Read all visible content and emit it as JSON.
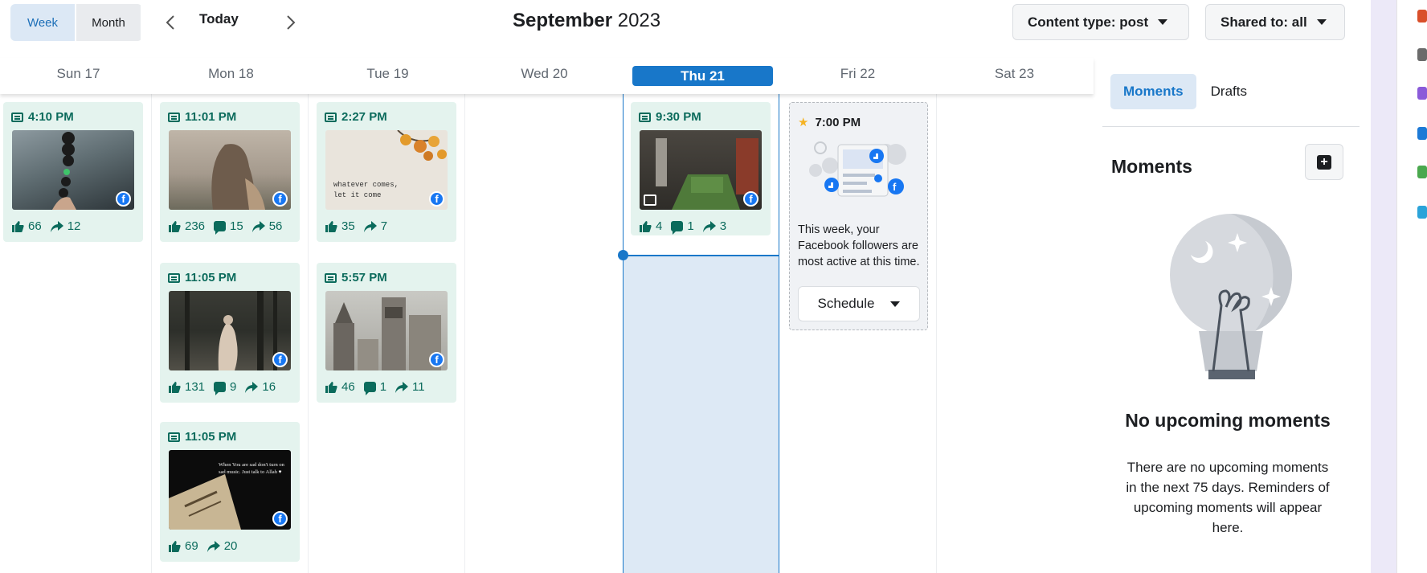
{
  "toolbar": {
    "week_label": "Week",
    "month_label": "Month",
    "today_label": "Today",
    "prev_icon": "chevron-left-icon",
    "next_icon": "chevron-right-icon",
    "month_name": "September",
    "year": "2023",
    "content_type_label": "Content type: post",
    "shared_to_label": "Shared to: all"
  },
  "days": [
    {
      "label": "Sun 17",
      "today": false
    },
    {
      "label": "Mon 18",
      "today": false
    },
    {
      "label": "Tue 19",
      "today": false
    },
    {
      "label": "Wed 20",
      "today": false
    },
    {
      "label": "Thu 21",
      "today": true
    },
    {
      "label": "Fri 22",
      "today": false
    },
    {
      "label": "Sat 23",
      "today": false
    }
  ],
  "posts": {
    "sun_1": {
      "time": "4:10 PM",
      "likes": "66",
      "shares": "12"
    },
    "mon_1": {
      "time": "11:01 PM",
      "likes": "236",
      "comments": "15",
      "shares": "56"
    },
    "mon_2": {
      "time": "11:05 PM",
      "likes": "131",
      "comments": "9",
      "shares": "16"
    },
    "mon_3": {
      "time": "11:05 PM",
      "likes": "69",
      "shares": "20"
    },
    "tue_1": {
      "time": "2:27 PM",
      "likes": "35",
      "shares": "7"
    },
    "tue_2": {
      "time": "5:57 PM",
      "likes": "46",
      "comments": "1",
      "shares": "11"
    },
    "thu_1": {
      "time": "9:30 PM",
      "likes": "4",
      "comments": "1",
      "shares": "3"
    }
  },
  "thumb_text": {
    "tue_1_line1": "whatever comes,",
    "tue_1_line2": "let it come",
    "mon_3_line1": "When You are sad don't turn on",
    "mon_3_line2": "sad music. Just talk to Allah ♥"
  },
  "suggestion": {
    "time": "7:00 PM",
    "text": "This week, your Facebook followers are most active at this time.",
    "button_label": "Schedule"
  },
  "right_panel": {
    "tab_moments": "Moments",
    "tab_drafts": "Drafts",
    "title": "Moments",
    "empty_title": "No upcoming moments",
    "empty_text": "There are no upcoming moments in the next 75 days. Reminders of upcoming moments will appear here."
  },
  "colors": {
    "accent": "#1877c9",
    "card_bg": "#e4f3ee",
    "card_text": "#0b6b5c",
    "facebook": "#1877f2"
  }
}
